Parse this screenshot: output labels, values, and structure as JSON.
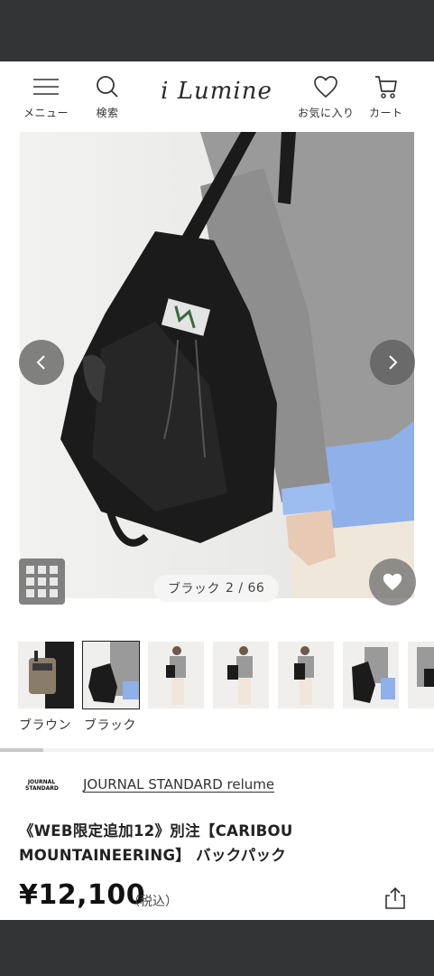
{
  "header": {
    "menu_label": "メニュー",
    "search_label": "検索",
    "logo_text": "i Lumine",
    "favorites_label": "お気に入り",
    "cart_label": "カート"
  },
  "gallery": {
    "color_name": "ブラック",
    "position": "2 / 66",
    "current_index": 2,
    "total": 66
  },
  "thumbnails": {
    "labels": [
      "ブラウン",
      "ブラック"
    ],
    "selected": "ブラック"
  },
  "product": {
    "brand_logo_text": "JOURNAL STANDARD",
    "brand": "JOURNAL STANDARD relume",
    "name_line1": "《WEB限定追加12》別注【CARIBOU",
    "name_line2": "MOUNTAINEERING】 バックパック",
    "price": "¥12,100",
    "tax_note": "（税込）"
  },
  "icons": [
    "menu-icon",
    "search-icon",
    "heart-icon",
    "cart-icon",
    "chevron-left-icon",
    "chevron-right-icon",
    "grid-icon",
    "heart-filled-icon",
    "share-icon"
  ],
  "colors": {
    "system_bar": "#333436",
    "overlay_button": "#5a5a5a",
    "text": "#222222"
  }
}
